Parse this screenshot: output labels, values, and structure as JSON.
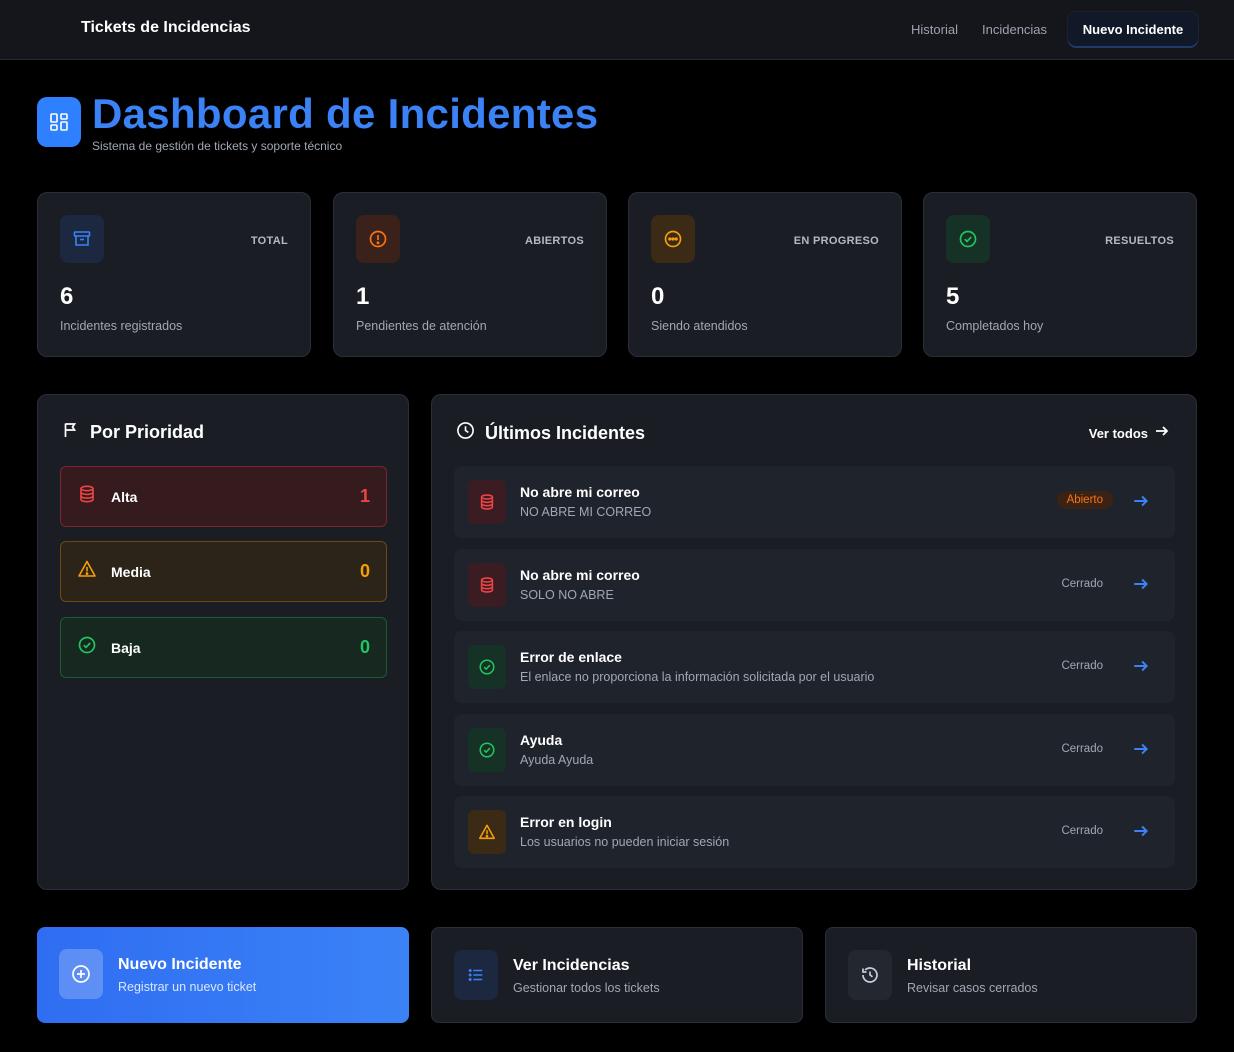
{
  "nav": {
    "brand": "Tickets de Incidencias",
    "links": [
      "Historial",
      "Incidencias"
    ],
    "cta": "Nuevo Incidente"
  },
  "header": {
    "icon": "dashboard-grid-icon",
    "title": "Dashboard de Incidentes",
    "subtitle": "Sistema de gestión de tickets y soporte técnico"
  },
  "stats": [
    {
      "label": "TOTAL",
      "value": "6",
      "desc": "Incidentes registrados",
      "icon": "archive-icon",
      "color": "#3b82f6"
    },
    {
      "label": "ABIERTOS",
      "value": "1",
      "desc": "Pendientes de atención",
      "icon": "alert-circle-icon",
      "color": "#f97316"
    },
    {
      "label": "EN PROGRESO",
      "value": "0",
      "desc": "Siendo atendidos",
      "icon": "dots-circle-icon",
      "color": "#f59e0b"
    },
    {
      "label": "RESUELTOS",
      "value": "5",
      "desc": "Completados hoy",
      "icon": "check-circle-icon",
      "color": "#22c55e"
    }
  ],
  "priority": {
    "title": "Por Prioridad",
    "items": [
      {
        "label": "Alta",
        "count": "1",
        "icon": "database-icon",
        "color": "#ef4444"
      },
      {
        "label": "Media",
        "count": "0",
        "icon": "warning-triangle-icon",
        "color": "#f59e0b"
      },
      {
        "label": "Baja",
        "count": "0",
        "icon": "check-circle-icon",
        "color": "#22c55e"
      }
    ]
  },
  "recent": {
    "title": "Últimos Incidentes",
    "view_all": "Ver todos",
    "items": [
      {
        "title": "No abre mi correo",
        "desc": "NO ABRE MI CORREO",
        "status": "Abierto",
        "priority": "alta"
      },
      {
        "title": "No abre mi correo",
        "desc": "SOLO NO ABRE",
        "status": "Cerrado",
        "priority": "alta"
      },
      {
        "title": "Error de enlace",
        "desc": "El enlace no proporciona la información solicitada por el usuario",
        "status": "Cerrado",
        "priority": "baja"
      },
      {
        "title": "Ayuda",
        "desc": "Ayuda Ayuda",
        "status": "Cerrado",
        "priority": "baja"
      },
      {
        "title": "Error en login",
        "desc": "Los usuarios no pueden iniciar sesión",
        "status": "Cerrado",
        "priority": "media"
      }
    ]
  },
  "actions": [
    {
      "title": "Nuevo Incidente",
      "desc": "Registrar un nuevo ticket",
      "icon": "plus-circle-icon"
    },
    {
      "title": "Ver Incidencias",
      "desc": "Gestionar todos los tickets",
      "icon": "list-icon"
    },
    {
      "title": "Historial",
      "desc": "Revisar casos cerrados",
      "icon": "history-icon"
    }
  ],
  "colors": {
    "accent": "#3b82f6",
    "alta": "#ef4444",
    "media": "#f59e0b",
    "baja": "#22c55e",
    "open": "#f97316"
  }
}
